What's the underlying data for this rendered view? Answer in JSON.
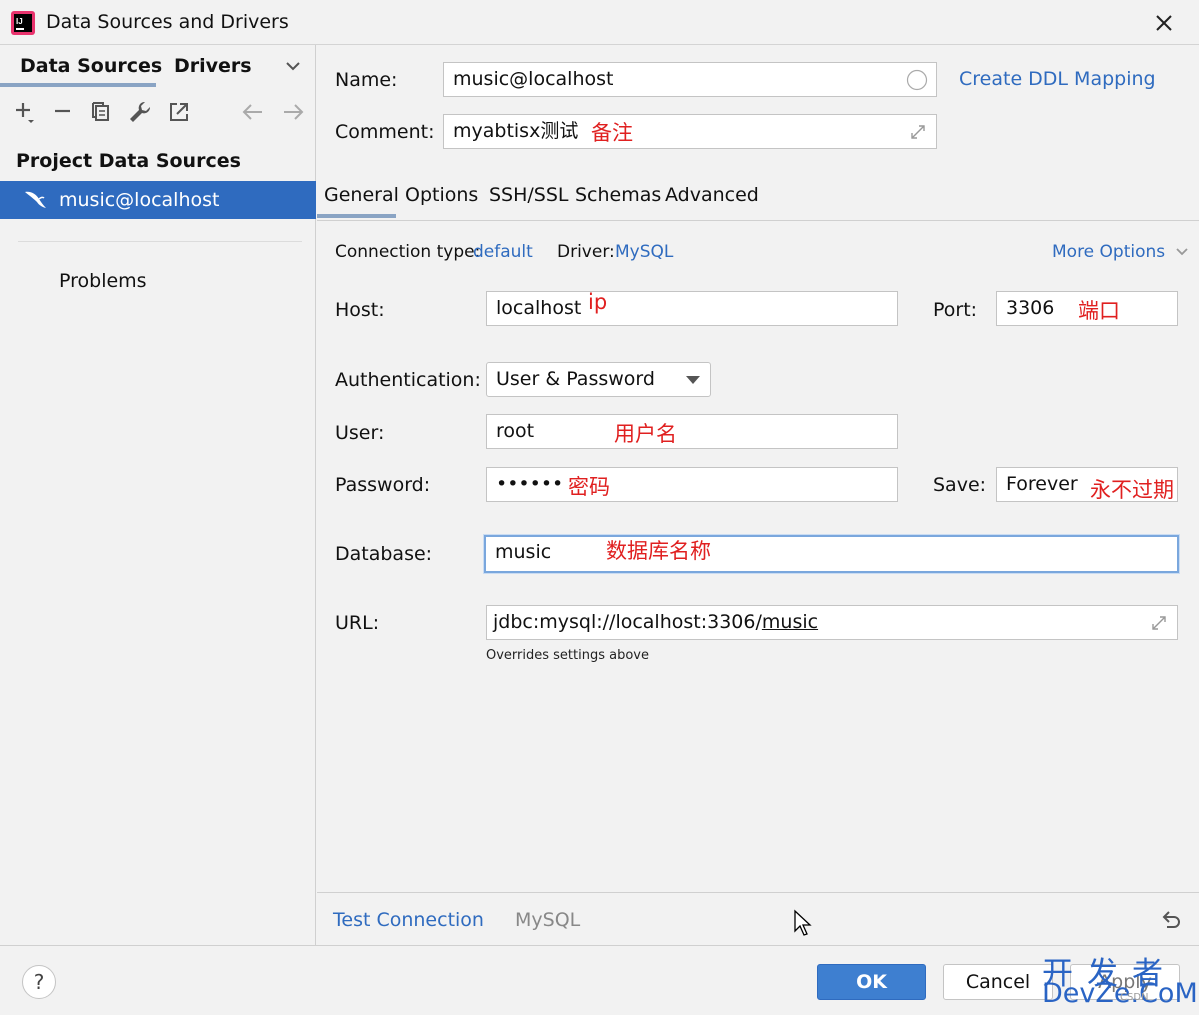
{
  "window": {
    "title": "Data Sources and Drivers",
    "app_icon": "intellij-idea-icon",
    "close_icon": "close-icon"
  },
  "left": {
    "tabs": [
      "Data Sources",
      "Drivers"
    ],
    "active_tab": "Data Sources",
    "toolbar_icons": [
      "add-icon",
      "remove-icon",
      "duplicate-icon",
      "wrench-icon",
      "export-icon",
      "back-arrow-icon",
      "forward-arrow-icon"
    ],
    "section_header": "Project Data Sources",
    "data_sources": [
      {
        "name": "music@localhost",
        "icon": "mysql-dolphin-icon",
        "selected": true
      }
    ],
    "problems_label": "Problems"
  },
  "form": {
    "name_label": "Name:",
    "name_value": "music@localhost",
    "create_ddl_link": "Create DDL Mapping",
    "comment_label": "Comment:",
    "comment_value": "myabtisx测试",
    "comment_annotation": "备注",
    "tabs": [
      "General",
      "Options",
      "SSH/SSL",
      "Schemas",
      "Advanced"
    ],
    "active_tab": "General",
    "connection_type_label": "Connection type:",
    "connection_type_value": "default",
    "driver_label": "Driver:",
    "driver_value": "MySQL",
    "more_options": "More Options",
    "host_label": "Host:",
    "host_value": "localhost",
    "host_annotation": "ip",
    "port_label": "Port:",
    "port_value": "3306",
    "port_annotation": "端口",
    "auth_label": "Authentication:",
    "auth_value": "User & Password",
    "user_label": "User:",
    "user_value": "root",
    "user_annotation": "用户名",
    "password_label": "Password:",
    "password_value": "••••••",
    "password_annotation": "密码",
    "save_label": "Save:",
    "save_value": "Forever",
    "save_annotation": "永不过期",
    "database_label": "Database:",
    "database_value": "music",
    "database_annotation": "数据库名称",
    "url_label": "URL:",
    "url_prefix": "jdbc:mysql://localhost:3306/",
    "url_db": "music",
    "url_hint": "Overrides settings above"
  },
  "bottom_bar": {
    "test_connection": "Test Connection",
    "driver_name": "MySQL",
    "revert_icon": "revert-icon"
  },
  "footer": {
    "help": "?",
    "ok": "OK",
    "cancel": "Cancel",
    "apply": "Apply"
  },
  "watermark": {
    "line1": "开发者",
    "line2": "DevZe.CoM",
    "small": "CSDN"
  },
  "colors": {
    "accent": "#2f6bbf",
    "annotation": "#e02020",
    "background": "#f2f2f2"
  }
}
